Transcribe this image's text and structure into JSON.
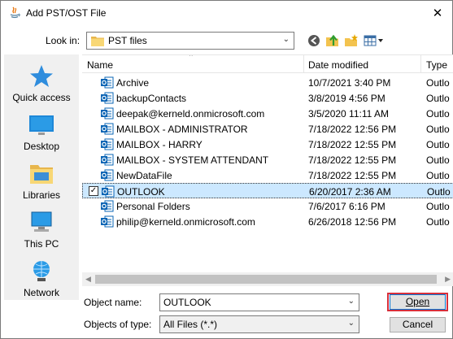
{
  "window": {
    "title": "Add PST/OST File",
    "close_symbol": "✕"
  },
  "toolbar": {
    "lookin_label": "Look in:",
    "lookin_value": "PST files",
    "buttons": [
      "back-icon",
      "up-folder-icon",
      "new-folder-icon",
      "view-menu-icon"
    ]
  },
  "places": [
    {
      "label": "Quick access",
      "icon": "quick-access-star-icon"
    },
    {
      "label": "Desktop",
      "icon": "desktop-icon"
    },
    {
      "label": "Libraries",
      "icon": "libraries-icon"
    },
    {
      "label": "This PC",
      "icon": "this-pc-icon"
    },
    {
      "label": "Network",
      "icon": "network-icon"
    }
  ],
  "columns": {
    "name": "Name",
    "date": "Date modified",
    "type": "Type"
  },
  "files": [
    {
      "name": "Archive",
      "date": "10/7/2021 3:40 PM",
      "type": "Outlo"
    },
    {
      "name": "backupContacts",
      "date": "3/8/2019 4:56 PM",
      "type": "Outlo"
    },
    {
      "name": "deepak@kerneld.onmicrosoft.com",
      "date": "3/5/2020 11:11 AM",
      "type": "Outlo"
    },
    {
      "name": "MAILBOX - ADMINISTRATOR",
      "date": "7/18/2022 12:56 PM",
      "type": "Outlo"
    },
    {
      "name": "MAILBOX - HARRY",
      "date": "7/18/2022 12:55 PM",
      "type": "Outlo"
    },
    {
      "name": "MAILBOX - SYSTEM ATTENDANT",
      "date": "7/18/2022 12:55 PM",
      "type": "Outlo"
    },
    {
      "name": "NewDataFile",
      "date": "7/18/2022 12:55 PM",
      "type": "Outlo"
    },
    {
      "name": "OUTLOOK",
      "date": "6/20/2017 2:36 AM",
      "type": "Outlo",
      "selected": true
    },
    {
      "name": "Personal Folders",
      "date": "7/6/2017 6:16 PM",
      "type": "Outlo"
    },
    {
      "name": "philip@kerneld.onmicrosoft.com",
      "date": "6/26/2018 12:56 PM",
      "type": "Outlo"
    }
  ],
  "form": {
    "object_name_label": "Object name:",
    "object_name_value": "OUTLOOK",
    "object_type_label": "Objects of type:",
    "object_type_value": "All Files (*.*)",
    "open_label": "Open",
    "cancel_label": "Cancel"
  },
  "colors": {
    "selection": "#cce8ff",
    "highlight_outline": "#d62f3b",
    "accent": "#0078d7"
  }
}
